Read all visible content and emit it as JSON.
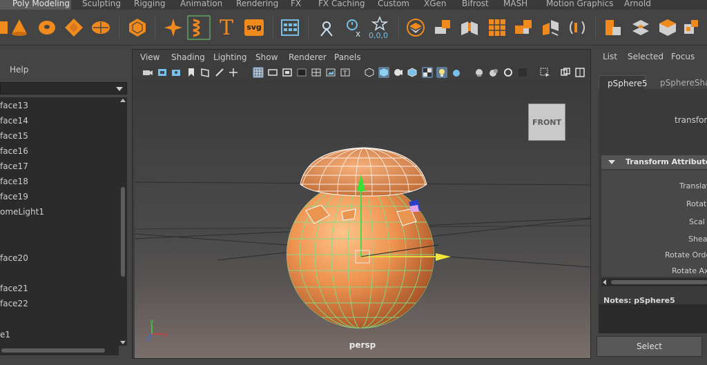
{
  "shelf": {
    "tabs": [
      "Poly Modeling",
      "Sculpting",
      "Rigging",
      "Animation",
      "Rendering",
      "FX",
      "FX Caching",
      "Custom",
      "XGen",
      "Bifrost",
      "MASH",
      "Motion Graphics",
      "Arnold"
    ],
    "active_tab": "Poly Modeling",
    "icons": [
      "cone-icon",
      "torus-icon",
      "diamond-icon",
      "disc-icon",
      "platonic-icon",
      "sparkle-icon",
      "helix-icon",
      "text-tool-icon",
      "svg-tool-icon",
      "type-grid-icon",
      "pivot-icon",
      "snap-icon",
      "zero-transform-icon",
      "bevel-icon",
      "extrude-icon",
      "bridge-icon",
      "multicut-icon",
      "combine-icon",
      "separate-icon",
      "mirror-icon",
      "booleans-icon",
      "quad-draw-icon",
      "target-weld-icon",
      "uv-editor-icon"
    ],
    "svg_label": "svg",
    "zero_label": "0,0,0",
    "text_glyph": "T"
  },
  "left_panel": {
    "menu_label": "Help",
    "outliner_items": [
      "face13",
      "face14",
      "face15",
      "face16",
      "face17",
      "face18",
      "face19",
      "omeLight1",
      "face20",
      "face21",
      "face22",
      "e1"
    ]
  },
  "viewport": {
    "menu": [
      "View",
      "Shading",
      "Lighting",
      "Show",
      "Renderer",
      "Panels"
    ],
    "camera_label": "persp",
    "viewcube_label": "FRONT",
    "axis_labels": {
      "x": "x",
      "y": "y",
      "z": "z"
    },
    "toolbar_icons": [
      "camera-select-icon",
      "lock-camera-icon",
      "camera-attrs-icon",
      "bookmark-icon",
      "image-plane-icon",
      "grease-pencil-icon",
      "2d-pan-icon",
      "grid-icon",
      "film-gate-icon",
      "resolution-gate-icon",
      "gate-mask-icon",
      "field-chart-icon",
      "safe-action-icon",
      "safe-title-icon",
      "wireframe-icon",
      "smooth-shade-icon",
      "wireframe-on-shaded-icon",
      "textured-icon",
      "lights-icon",
      "shadows-icon",
      "screen-space-ao-icon",
      "motion-blur-icon",
      "multisample-aa-icon",
      "depth-of-field-icon",
      "isolate-select-icon",
      "xray-icon",
      "xray-joints-icon",
      "xray-components-icon",
      "two-pane-icon",
      "camera-pan-icon"
    ]
  },
  "attribute_editor": {
    "menu": [
      "List",
      "Selected",
      "Focus"
    ],
    "tabs": [
      "pSphere5",
      "pSphereShap"
    ],
    "node_type_label": "transform",
    "section_title": "Transform Attributes",
    "attributes": [
      "Translat",
      "Rotat",
      "Scal",
      "Shea",
      "Rotate Orde",
      "Rotate Axi"
    ],
    "notes_label": "Notes:  pSphere5",
    "select_button": "Select"
  },
  "colors": {
    "accent_orange": "#f08a1c",
    "sphere_orange": "#e98c4c",
    "wire_green": "#7fe08a",
    "toolbar_active": "#5e7c98"
  }
}
